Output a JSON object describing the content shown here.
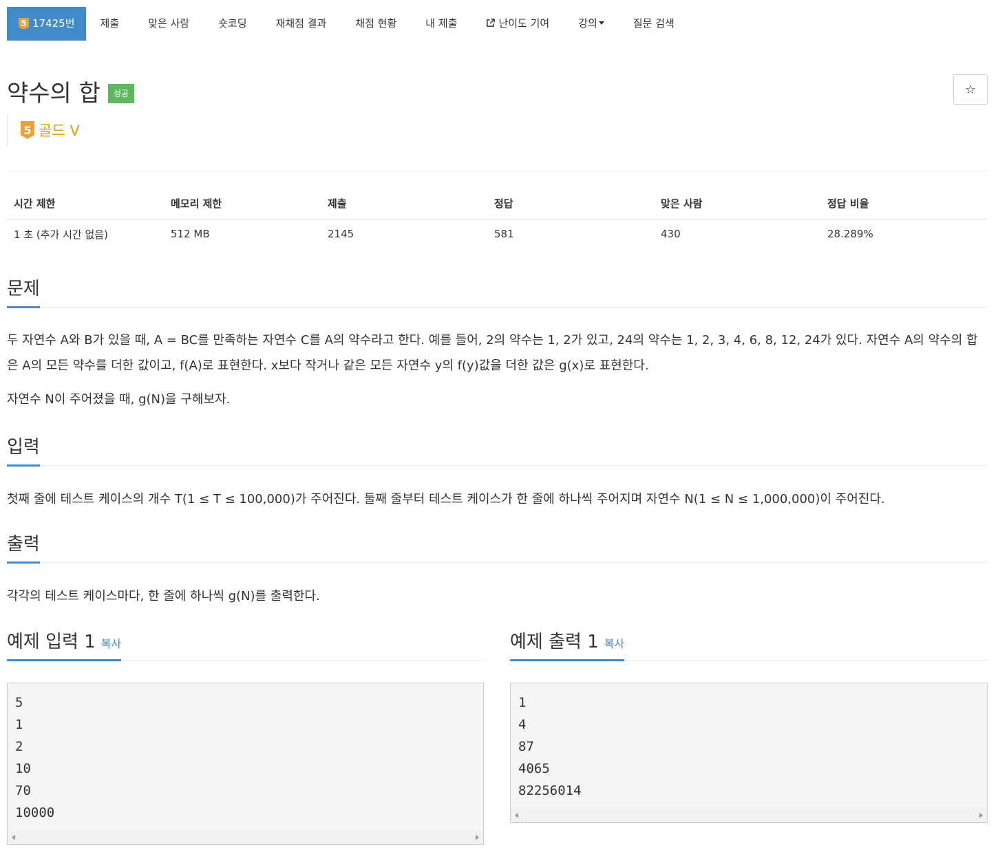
{
  "nav": {
    "problem_badge": "5",
    "problem_id": "17425번",
    "items": [
      "제출",
      "맞은 사람",
      "숏코딩",
      "재채점 결과",
      "채점 현황",
      "내 제출"
    ],
    "contribute_label": "난이도 기여",
    "contribute_icon": "external-link-icon",
    "lecture_label": "강의",
    "search_label": "질문 검색"
  },
  "problem": {
    "title": "약수의 합",
    "status": "성공",
    "tier_badge": "5",
    "tier": "골드 V",
    "star": "☆"
  },
  "info": {
    "headers": [
      "시간 제한",
      "메모리 제한",
      "제출",
      "정답",
      "맞은 사람",
      "정답 비율"
    ],
    "values": [
      "1 초 (추가 시간 없음)",
      "512 MB",
      "2145",
      "581",
      "430",
      "28.289%"
    ]
  },
  "sections": {
    "description_title": "문제",
    "description": [
      "두 자연수 A와 B가 있을 때, A = BC를 만족하는 자연수 C를 A의 약수라고 한다. 예를 들어, 2의 약수는 1, 2가 있고, 24의 약수는 1, 2, 3, 4, 6, 8, 12, 24가 있다. 자연수 A의 약수의 합은 A의 모든 약수를 더한 값이고, f(A)로 표현한다. x보다 작거나 같은 모든 자연수 y의 f(y)값을 더한 값은 g(x)로 표현한다.",
      "자연수 N이 주어졌을 때, g(N)을 구해보자."
    ],
    "input_title": "입력",
    "input": "첫째 줄에 테스트 케이스의 개수 T(1 ≤ T ≤ 100,000)가 주어진다. 둘째 줄부터 테스트 케이스가 한 줄에 하나씩 주어지며 자연수 N(1 ≤ N ≤ 1,000,000)이 주어진다.",
    "output_title": "출력",
    "output": "각각의 테스트 케이스마다, 한 줄에 하나씩 g(N)를 출력한다."
  },
  "examples": {
    "input_title": "예제 입력 1",
    "output_title": "예제 출력 1",
    "copy_label": "복사",
    "input_lines": [
      "5",
      "1",
      "2",
      "10",
      "70",
      "10000"
    ],
    "output_lines": [
      "1",
      "4",
      "87",
      "4065",
      "82256014"
    ]
  }
}
